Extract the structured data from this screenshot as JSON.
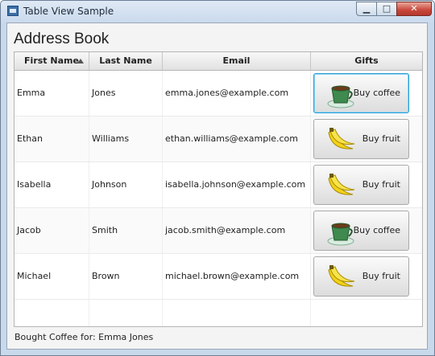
{
  "window": {
    "title": "Table View Sample",
    "minimize_glyph": "▁",
    "maximize_glyph": "□",
    "close_glyph": "✕"
  },
  "heading": "Address Book",
  "table": {
    "columns": [
      "First Name",
      "Last Name",
      "Email",
      "Gifts"
    ],
    "sorted_column": "First Name",
    "sort_direction": "ascending",
    "rows": [
      {
        "first": "Emma",
        "last": "Jones",
        "email": "emma.jones@example.com",
        "gift": "Buy coffee",
        "gift_icon": "coffee-cup-icon"
      },
      {
        "first": "Ethan",
        "last": "Williams",
        "email": "ethan.williams@example.com",
        "gift": "Buy fruit",
        "gift_icon": "banana-icon"
      },
      {
        "first": "Isabella",
        "last": "Johnson",
        "email": "isabella.johnson@example.com",
        "gift": "Buy fruit",
        "gift_icon": "banana-icon"
      },
      {
        "first": "Jacob",
        "last": "Smith",
        "email": "jacob.smith@example.com",
        "gift": "Buy coffee",
        "gift_icon": "coffee-cup-icon"
      },
      {
        "first": "Michael",
        "last": "Brown",
        "email": "michael.brown@example.com",
        "gift": "Buy fruit",
        "gift_icon": "banana-icon"
      }
    ]
  },
  "status": "Bought Coffee for: Emma Jones",
  "colors": {
    "focus_ring": "#2a9fd6",
    "window_frame": "#6e7f95",
    "close_button": "#c9463a"
  }
}
